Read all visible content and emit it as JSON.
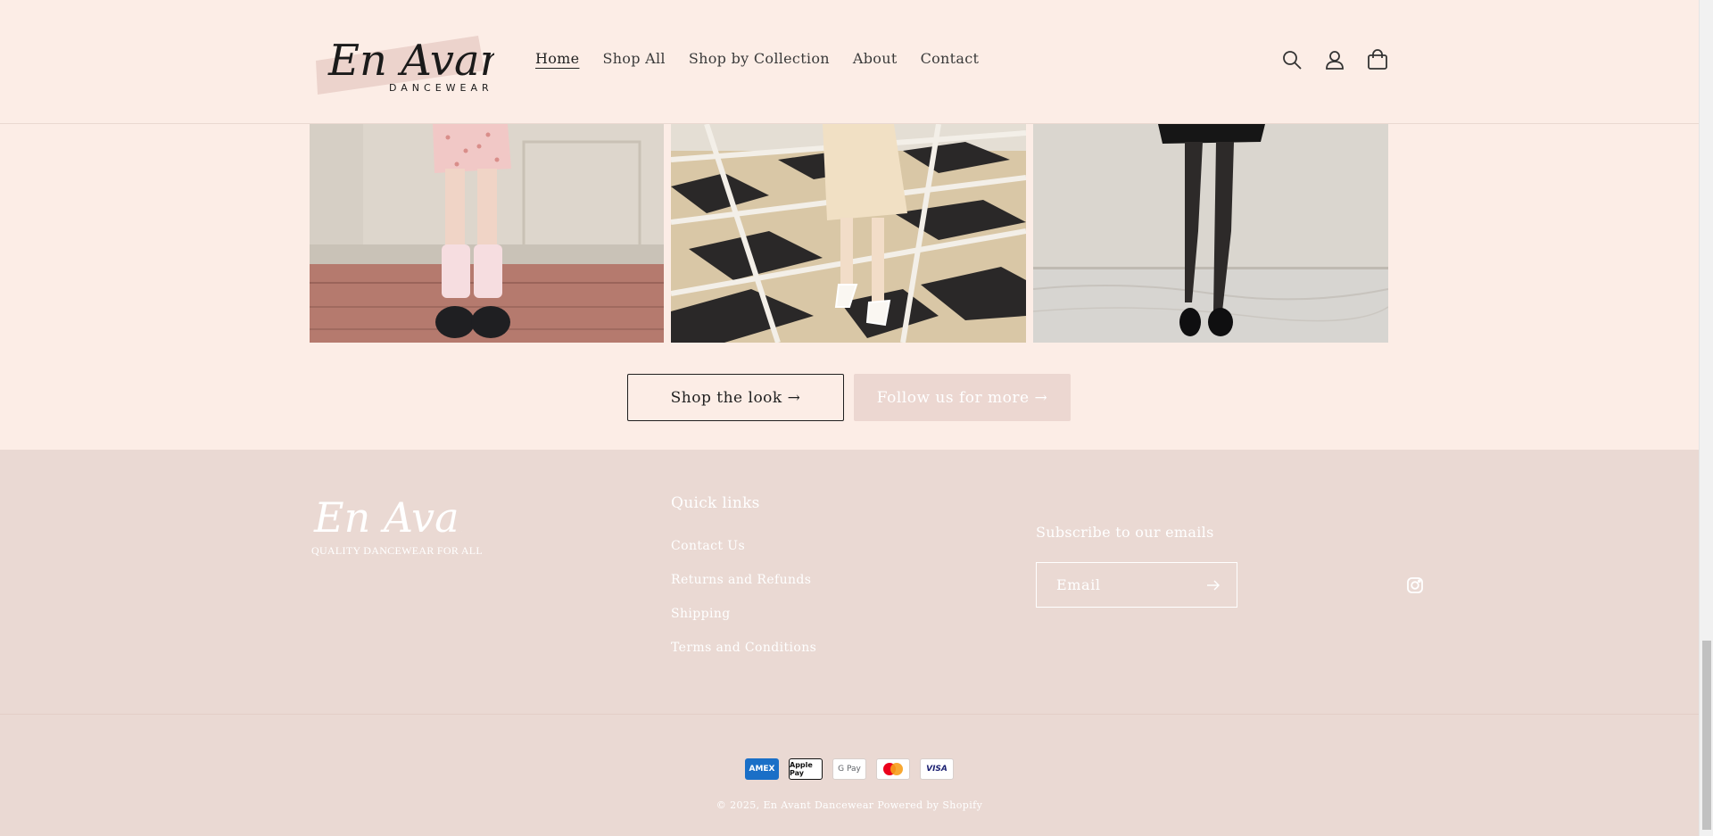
{
  "header": {
    "logo": {
      "script": "En Avant",
      "sub": "DANCEWEAR"
    },
    "nav": [
      "Home",
      "Shop All",
      "Shop by Collection",
      "About",
      "Contact"
    ],
    "icons": [
      "search-icon",
      "account-icon",
      "cart-icon"
    ]
  },
  "gallery": {
    "photos": [
      "photo-pink-leg-warmers",
      "photo-cream-dress-checkered-floor",
      "photo-black-dress-tights"
    ]
  },
  "buttons": {
    "shop_look": "Shop the look →",
    "follow": "Follow us for more →"
  },
  "footer": {
    "logo_script": "En Avant",
    "tagline": "QUALITY DANCEWEAR FOR ALL",
    "quick_links_title": "Quick links",
    "quick_links": [
      "Contact Us",
      "Returns and Refunds",
      "Shipping",
      "Terms and Conditions"
    ],
    "subscribe_title": "Subscribe to our emails",
    "email_placeholder": "Email",
    "payment_methods": [
      "AMEX",
      "Apple Pay",
      "G Pay",
      "Mastercard",
      "VISA"
    ],
    "copyright_prefix": "© 2025,",
    "copyright_store": "En Avant Dancewear",
    "powered_by": "Powered by Shopify"
  },
  "colors": {
    "background": "#fcede6",
    "footer_bg": "#ead9d3",
    "follow_button_bg": "#ecd7d1"
  }
}
